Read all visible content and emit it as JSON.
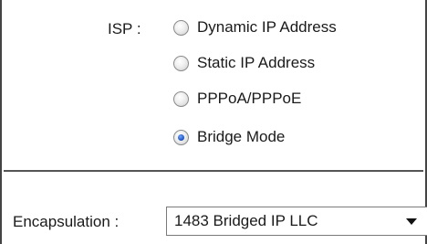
{
  "isp": {
    "label": "ISP :",
    "options": [
      {
        "label": "Dynamic IP Address",
        "selected": false
      },
      {
        "label": "Static IP Address",
        "selected": false
      },
      {
        "label": "PPPoA/PPPoE",
        "selected": false
      },
      {
        "label": "Bridge Mode",
        "selected": true
      }
    ]
  },
  "encapsulation": {
    "label": "Encapsulation :",
    "value": "1483 Bridged IP LLC",
    "icon": "chevron-down-icon"
  }
}
